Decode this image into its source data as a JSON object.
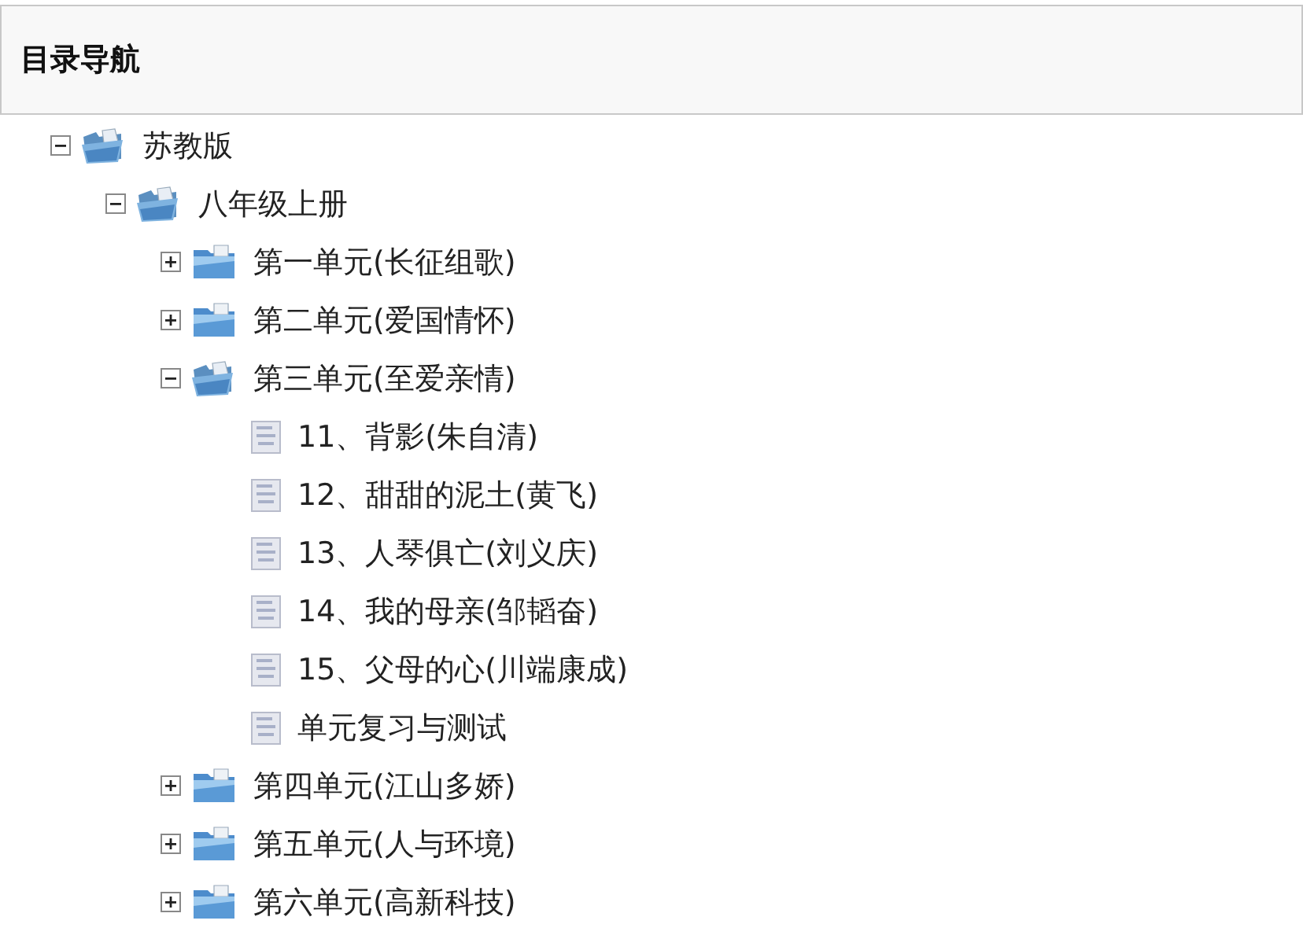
{
  "panel": {
    "title": "目录导航"
  },
  "tree": [
    {
      "kind": "folder",
      "label": "苏教版",
      "expanded": true,
      "children": [
        {
          "kind": "folder",
          "label": "八年级上册",
          "expanded": true,
          "children": [
            {
              "kind": "folder",
              "label": "第一单元(长征组歌)",
              "expanded": false
            },
            {
              "kind": "folder",
              "label": "第二单元(爱国情怀)",
              "expanded": false
            },
            {
              "kind": "folder",
              "label": "第三单元(至爱亲情)",
              "expanded": true,
              "children": [
                {
                  "kind": "page",
                  "label": "11、背影(朱自清)"
                },
                {
                  "kind": "page",
                  "label": "12、甜甜的泥土(黄飞)"
                },
                {
                  "kind": "page",
                  "label": "13、人琴俱亡(刘义庆)"
                },
                {
                  "kind": "page",
                  "label": "14、我的母亲(邹韬奋)"
                },
                {
                  "kind": "page",
                  "label": "15、父母的心(川端康成)"
                },
                {
                  "kind": "page",
                  "label": "单元复习与测试"
                }
              ]
            },
            {
              "kind": "folder",
              "label": "第四单元(江山多娇)",
              "expanded": false
            },
            {
              "kind": "folder",
              "label": "第五单元(人与环境)",
              "expanded": false
            },
            {
              "kind": "folder",
              "label": "第六单元(高新科技)",
              "expanded": false
            }
          ]
        }
      ]
    }
  ]
}
